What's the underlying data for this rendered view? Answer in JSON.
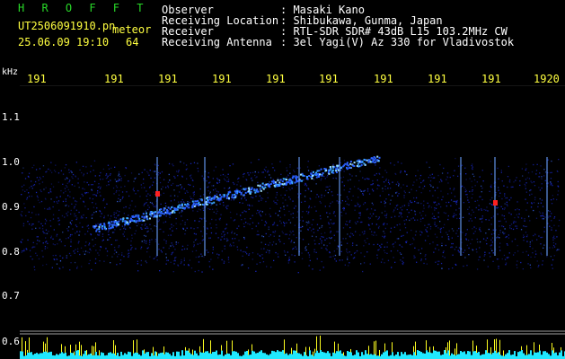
{
  "header": {
    "brand": "H R O F F T",
    "file_name": "UT2506091910.pn",
    "file_suffix": "meteor",
    "datetime": "25.06.09 19:10",
    "count": "64",
    "fields": [
      {
        "label": "Observer",
        "value": ": Masaki Kano"
      },
      {
        "label": "Receiving Location",
        "value": ": Shibukawa, Gunma, Japan"
      },
      {
        "label": "Receiver",
        "value": ": RTL-SDR SDR# 43dB L15 103.2MHz CW"
      },
      {
        "label": "Receiving Antenna",
        "value": ": 3el Yagi(V) Az 330 for Vladivostok"
      }
    ]
  },
  "axis": {
    "y_unit": "kHz",
    "y_labels": [
      "1.1",
      "1.0",
      "0.9",
      "0.8",
      "0.7",
      "0.6"
    ],
    "x_labels": [
      "191",
      "191",
      "191",
      "191",
      "191",
      "191",
      "191",
      "191",
      "191",
      "1920"
    ]
  },
  "colors": {
    "background": "#000000",
    "header_text": "#ffffff",
    "brand": "#28d828",
    "tick_text": "#ffff40",
    "noise_blue": "#1a2ad0",
    "histogram_cyan": "#20e8ff",
    "histogram_yellow": "#ffff20",
    "meteor_red": "#ff2020"
  }
}
